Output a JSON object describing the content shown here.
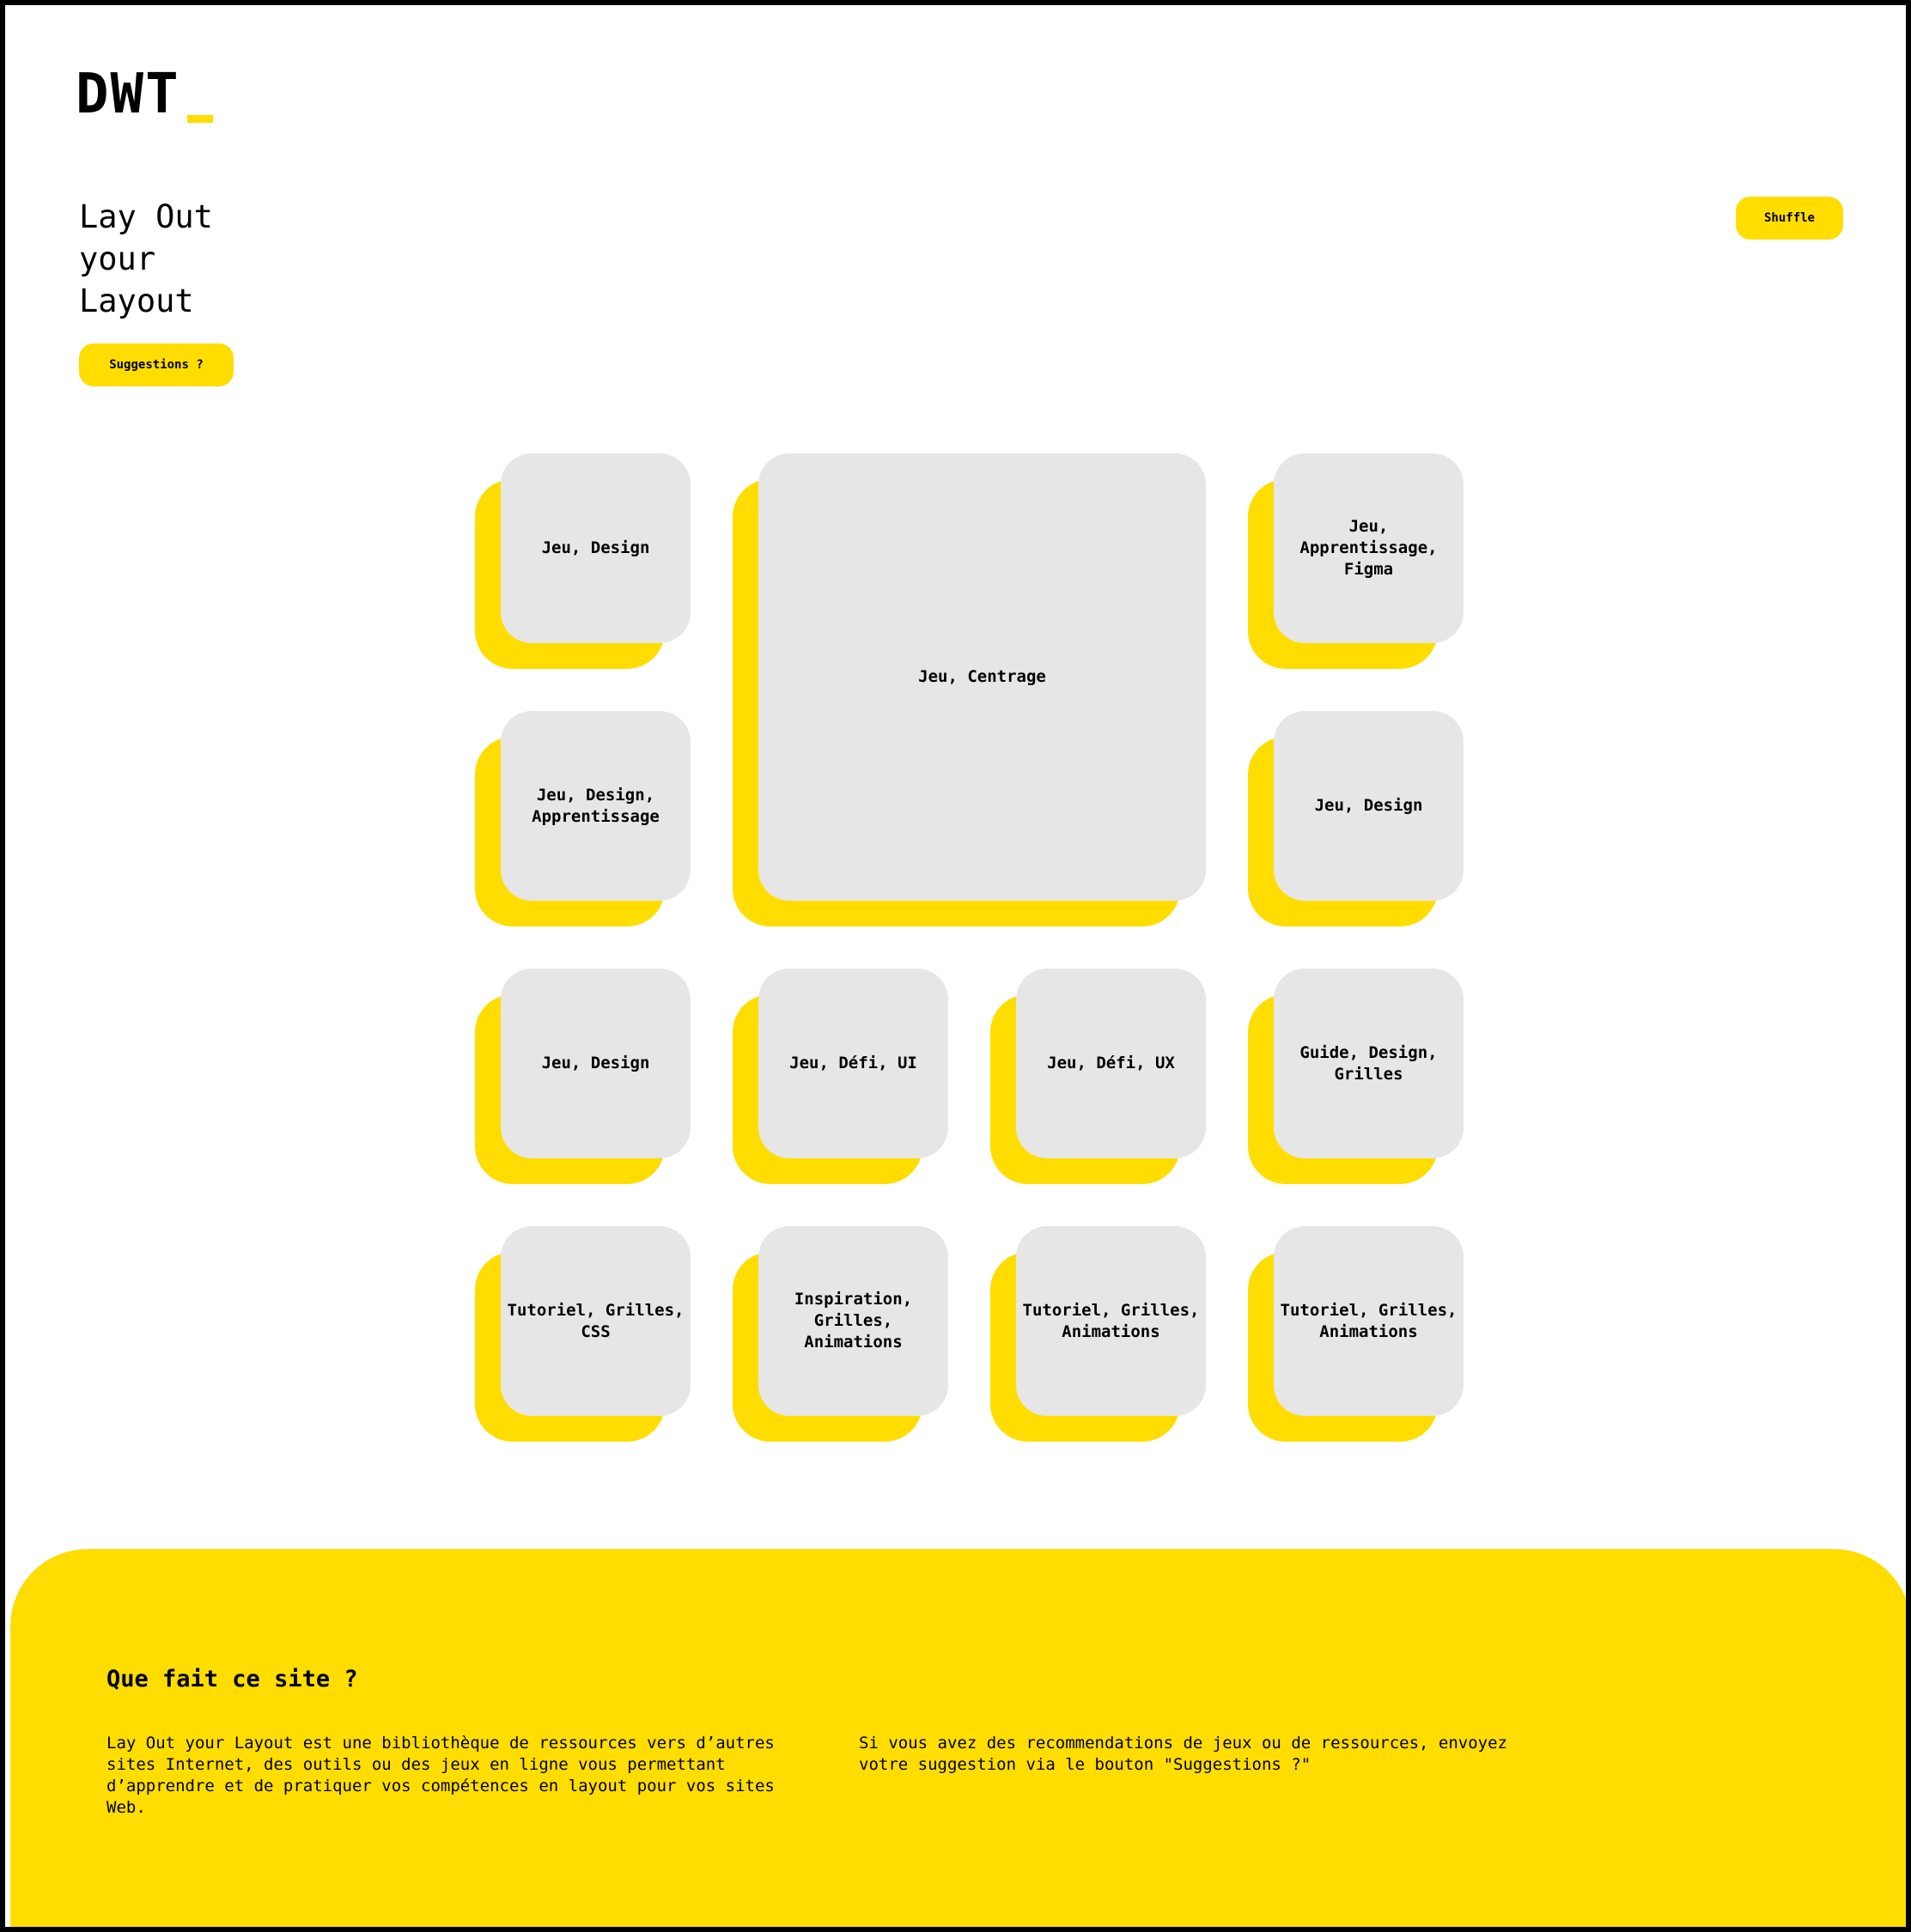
{
  "brand": {
    "logo_text": "DWT",
    "accent_color": "#FFDD00",
    "card_color": "#E6E6E6"
  },
  "hero": {
    "title": "Lay Out\nyour\nLayout",
    "suggestions_label": "Suggestions ?",
    "shuffle_label": "Shuffle"
  },
  "cards": [
    {
      "tags": "Jeu, Design"
    },
    {
      "tags": "Jeu, Centrage"
    },
    {
      "tags": "Jeu, Apprentissage, Figma"
    },
    {
      "tags": "Jeu, Design, Apprentissage"
    },
    {
      "tags": "Jeu, Design"
    },
    {
      "tags": "Jeu, Design"
    },
    {
      "tags": "Jeu, Défi, UI"
    },
    {
      "tags": "Jeu, Défi, UX"
    },
    {
      "tags": "Guide, Design, Grilles"
    },
    {
      "tags": "Tutoriel, Grilles, CSS"
    },
    {
      "tags": "Inspiration, Grilles, Animations"
    },
    {
      "tags": "Tutoriel, Grilles, Animations"
    },
    {
      "tags": "Tutoriel, Grilles, Animations"
    }
  ],
  "footer": {
    "title": "Que fait ce site ?",
    "left_text": "Lay Out your Layout est une bibliothèque de ressources vers d’autres sites Internet, des outils ou des jeux en ligne vous permettant d’apprendre et de pratiquer vos compétences en layout pour vos sites Web.",
    "right_text": "Si vous avez des recommendations de jeux ou de ressources, envoyez votre suggestion via le bouton \"Suggestions ?\""
  }
}
